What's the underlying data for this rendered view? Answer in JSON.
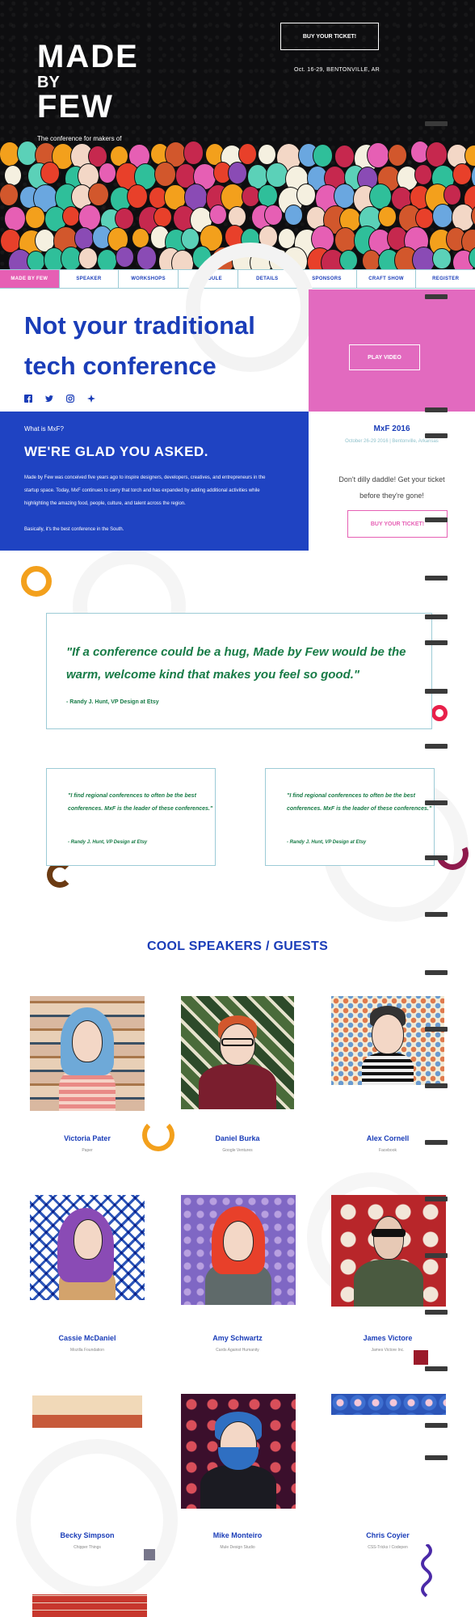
{
  "hero": {
    "logo_made": "MADE",
    "logo_by": "BY",
    "logo_few": "FEW",
    "tagline": "The conference for makers of the web.",
    "ticket_button": "BUY YOUR TICKET!",
    "event_meta": "Oct. 16-29, BENTONVILLE, AR"
  },
  "nav": {
    "items": [
      {
        "label": "MADE BY FEW"
      },
      {
        "label": "SPEAKER"
      },
      {
        "label": "WORKSHOPS"
      },
      {
        "label": "SCHEDULE"
      },
      {
        "label": "DETAILS"
      },
      {
        "label": "SPONSORS"
      },
      {
        "label": "CRAFT SHOW"
      },
      {
        "label": "REGISTER"
      }
    ]
  },
  "intro": {
    "headline": "Not your traditional tech conference",
    "socials": [
      "facebook-icon",
      "twitter-icon",
      "instagram-icon",
      "dribbble-icon"
    ],
    "play_video": "PLAY VIDEO"
  },
  "about": {
    "kicker": "What is MxF?",
    "title": "WE'RE GLAD YOU ASKED.",
    "body": "Made by Few was conceived five years ago to inspire designers, developers, creatives, and entrepreneurs in the startup space. Today, MxF continues to carry that torch and has expanded by adding additional activities while highlighting the amazing food, people, culture, and talent across the region.",
    "body2": "Basically, it's the best conference in the South."
  },
  "event_card": {
    "title": "MxF 2016",
    "meta": "October 26-29 2016 | Bentonville, Arkansas",
    "body": "Don't dilly daddle! Get your ticket before they're gone!",
    "button": "BUY YOUR TICKET!"
  },
  "quotes": {
    "big": {
      "text": "\"If a conference could be a hug, Made by Few would be the warm, welcome kind that makes you feel so good.\"",
      "cite": "- Randy J. Hunt, VP Design at Etsy"
    },
    "small": [
      {
        "text": "\"I find regional conferences to often be the best conferences. MxF is the leader of these conferences.\"",
        "cite": "- Randy J. Hunt, VP Design at Etsy"
      },
      {
        "text": "\"I find regional conferences to often be the best conferences. MxF is the leader of these conferences.\"",
        "cite": "- Randy J. Hunt, VP Design at Etsy"
      }
    ]
  },
  "speakers": {
    "title": "COOL SPEAKERS / GUESTS",
    "list": [
      {
        "name": "Victoria Pater",
        "org": "Paper"
      },
      {
        "name": "Daniel Burka",
        "org": "Google Ventures"
      },
      {
        "name": "Alex Cornell",
        "org": "Facebook"
      },
      {
        "name": "Cassie McDaniel",
        "org": "Mozilla Foundation"
      },
      {
        "name": "Amy Schwartz",
        "org": "Cards Against Humanity"
      },
      {
        "name": "James Victore",
        "org": "James Victore Inc."
      },
      {
        "name": "Becky Simpson",
        "org": "Chipper Things"
      },
      {
        "name": "Mike Monteiro",
        "org": "Mule Design Studio"
      },
      {
        "name": "Chris Coyier",
        "org": "CSS-Tricks / Codepen"
      }
    ]
  },
  "colors": {
    "brand_blue": "#1f43c2",
    "pink": "#e65fb4",
    "green": "#177b46",
    "teal_border": "#9ccbd6"
  }
}
